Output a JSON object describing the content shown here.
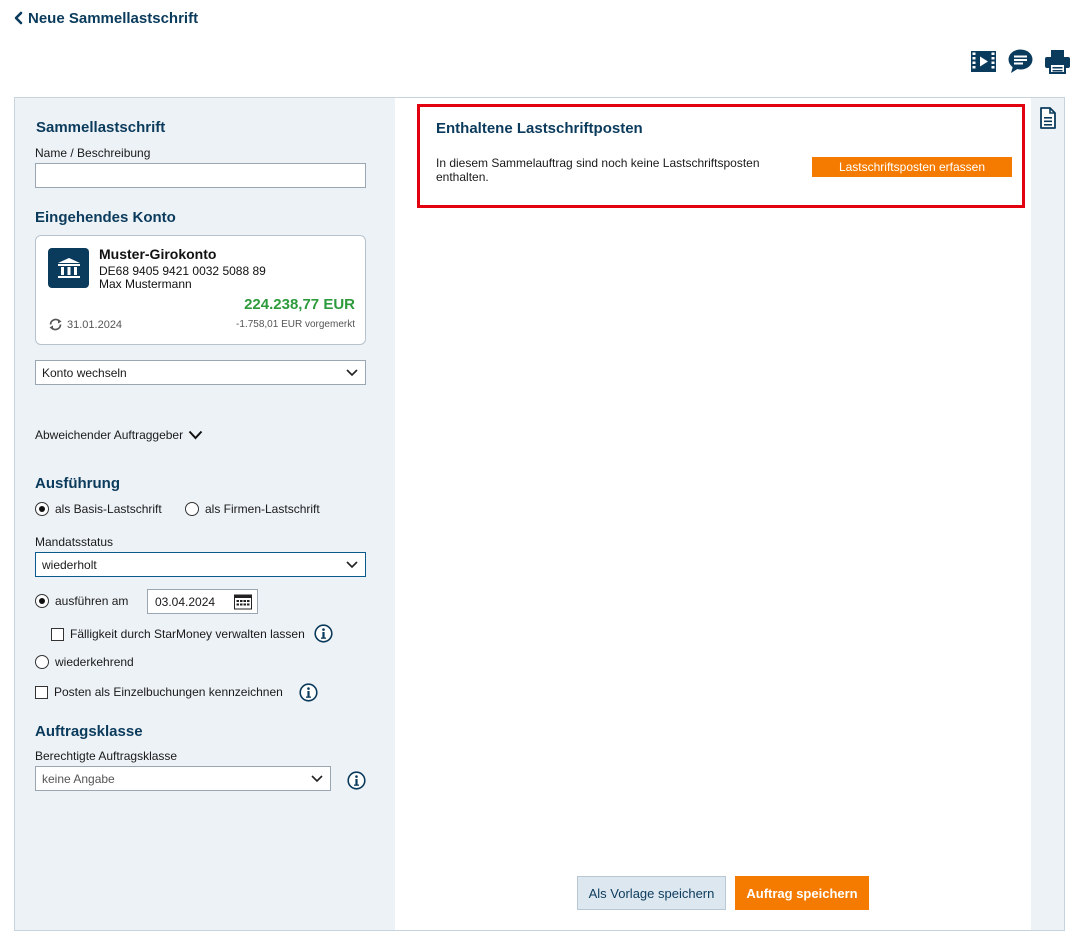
{
  "header": {
    "back_label": "Neue Sammellastschrift"
  },
  "toolbar": {
    "icons": [
      "video-icon",
      "chat-icon",
      "print-icon"
    ]
  },
  "left": {
    "section_title": "Sammellastschrift",
    "name_label": "Name / Beschreibung",
    "name_value": "",
    "account_title": "Eingehendes Konto",
    "account": {
      "name": "Muster-Girokonto",
      "iban": "DE68 9405 9421 0032 5088 89",
      "owner": "Max Mustermann",
      "balance": "224.238,77 EUR",
      "date": "31.01.2024",
      "pending": "-1.758,01 EUR vorgemerkt"
    },
    "switch_account_label": "Konto wechseln",
    "other_payer_label": "Abweichender Auftraggeber",
    "execution_title": "Ausführung",
    "radio_basis": "als Basis-Lastschrift",
    "radio_firmen": "als Firmen-Lastschrift",
    "mandate_label": "Mandatsstatus",
    "mandate_value": "wiederholt",
    "execute_on_label": "ausführen am",
    "execute_date": "03.04.2024",
    "due_label": "Fälligkeit durch StarMoney verwalten lassen",
    "recurring_label": "wiederkehrend",
    "single_booking_label": "Posten als Einzelbuchungen kennzeichnen",
    "order_class_title": "Auftragsklasse",
    "order_class_label": "Berechtigte Auftragsklasse",
    "order_class_value": "keine Angabe"
  },
  "panel": {
    "title": "Enthaltene Lastschriftposten",
    "text": "In diesem Sammelauftrag sind noch keine Lastschriftsposten enthalten.",
    "capture_button": "Lastschriftsposten erfassen"
  },
  "footer": {
    "template_button": "Als Vorlage speichern",
    "save_button": "Auftrag speichern"
  },
  "colors": {
    "primary": "#0b3b5c",
    "accent_orange": "#f47b00",
    "balance_green": "#2d9b3c",
    "highlight_red": "#e3000f",
    "panel_bg": "#edf2f6"
  }
}
